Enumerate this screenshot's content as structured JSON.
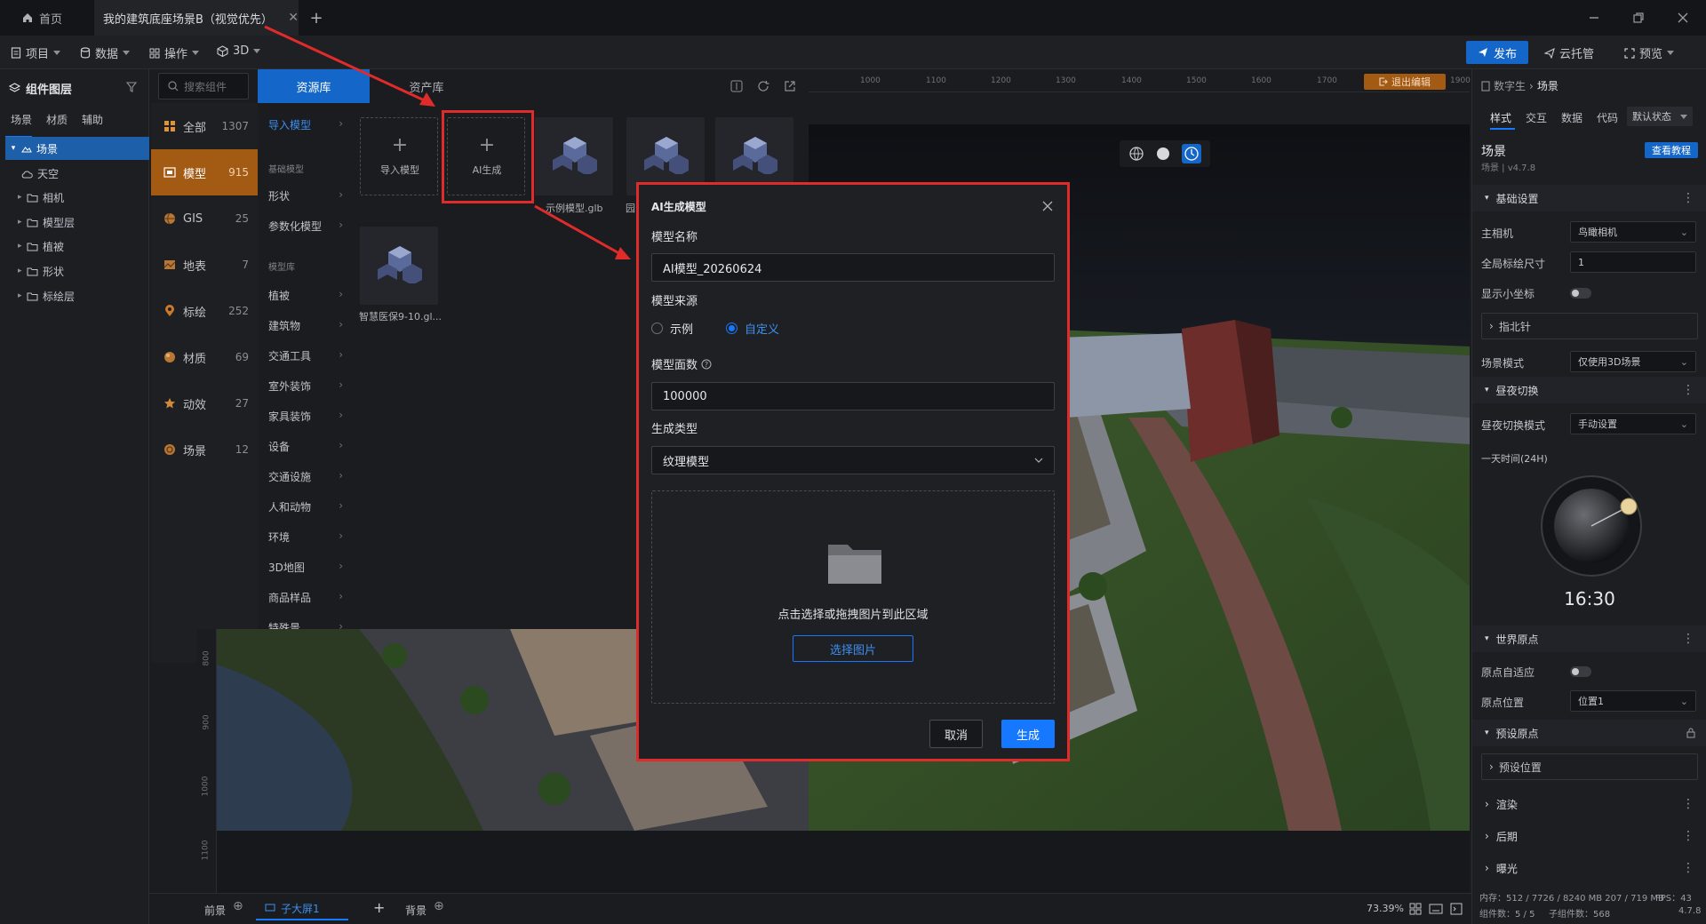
{
  "titlebar": {
    "home_tab": "首页",
    "project_tab": "我的建筑底座场景B（视觉优先）"
  },
  "menubar": {
    "items": [
      "项目",
      "数据",
      "操作",
      "3D"
    ],
    "publish": "发布",
    "cloud": "云托管",
    "preview": "预览"
  },
  "left_panel": {
    "title": "组件图层",
    "tabs": [
      "场景",
      "材质",
      "辅助"
    ],
    "tree": [
      "场景",
      "天空",
      "相机",
      "模型层",
      "植被",
      "形状",
      "标绘层"
    ]
  },
  "resource": {
    "search_placeholder": "搜索组件",
    "tabs": [
      "资源库",
      "资产库"
    ],
    "categories": [
      {
        "name": "全部",
        "count": "1307"
      },
      {
        "name": "模型",
        "count": "915"
      },
      {
        "name": "GIS",
        "count": "25"
      },
      {
        "name": "地表",
        "count": "7"
      },
      {
        "name": "标绘",
        "count": "252"
      },
      {
        "name": "材质",
        "count": "69"
      },
      {
        "name": "动效",
        "count": "27"
      },
      {
        "name": "场景",
        "count": "12"
      }
    ],
    "subcategories": {
      "import": "导入模型",
      "basic_head": "基础模型",
      "basic": [
        "形状",
        "参数化模型"
      ],
      "lib_head": "模型库",
      "lib": [
        "植被",
        "建筑物",
        "交通工具",
        "室外装饰",
        "家具装饰",
        "设备",
        "交通设施",
        "人和动物",
        "环境",
        "3D地图",
        "商品样品",
        "特殊景"
      ]
    },
    "assets": {
      "import_label": "导入模型",
      "ai_label": "AI生成",
      "sample": "示例模型.glb",
      "sample2": "园",
      "hospital": "智慧医保9-10.gl..."
    }
  },
  "ruler": {
    "top": [
      "1000",
      "1100",
      "1200",
      "1300",
      "1400",
      "1500",
      "1600",
      "1700",
      "1800",
      "1900"
    ],
    "left": [
      "800",
      "900",
      "1000",
      "1100"
    ],
    "exit_edit": "退出编辑"
  },
  "right_panel": {
    "breadcrumb": [
      "数字生",
      "场景"
    ],
    "tabs": [
      "样式",
      "交互",
      "数据",
      "代码"
    ],
    "state": "默认状态",
    "scene_title": "场景",
    "scene_version": "场景 | v4.7.8",
    "tutorial": "查看教程",
    "sections": {
      "basic": "基础设置",
      "compass": "指北针",
      "daynight": "昼夜切换",
      "origin": "世界原点",
      "preset": "预设原点",
      "preset_pos": "预设位置",
      "render": "渲染",
      "post": "后期",
      "exposure": "曝光"
    },
    "fields": {
      "main_camera_label": "主相机",
      "main_camera": "鸟瞰相机",
      "marker_size_label": "全局标绘尺寸",
      "marker_size": "1",
      "show_axis_label": "显示小坐标",
      "scene_mode_label": "场景模式",
      "scene_mode": "仅使用3D场景",
      "daynight_mode_label": "昼夜切换模式",
      "daynight_mode": "手动设置",
      "day_time_label": "一天时间(24H)",
      "day_time": "16:30",
      "origin_adapt_label": "原点自适应",
      "origin_pos_label": "原点位置",
      "origin_pos": "位置1"
    },
    "stats": {
      "memory": "内存：512 / 7726 / 8240 MB  207 / 719 MB",
      "fps": "FPS：43",
      "components": "组件数：5 / 5",
      "sub_components": "子组件数：568",
      "version": "4.7.8"
    }
  },
  "bottom": {
    "foreground": "前景",
    "screen": "子大屏1",
    "background": "背景",
    "zoom": "73.39%"
  },
  "modal": {
    "title": "AI生成模型",
    "name_label": "模型名称",
    "name_value": "AI模型_20260624",
    "source_label": "模型来源",
    "source_options": [
      "示例",
      "自定义"
    ],
    "faces_label": "模型面数",
    "faces_value": "100000",
    "type_label": "生成类型",
    "type_value": "纹理模型",
    "upload_text": "点击选择或拖拽图片到此区域",
    "upload_button": "选择图片",
    "cancel": "取消",
    "generate": "生成"
  },
  "colors": {
    "accent": "#1677ff",
    "selected_category": "#a35a13",
    "highlight": "#e02b2b"
  }
}
